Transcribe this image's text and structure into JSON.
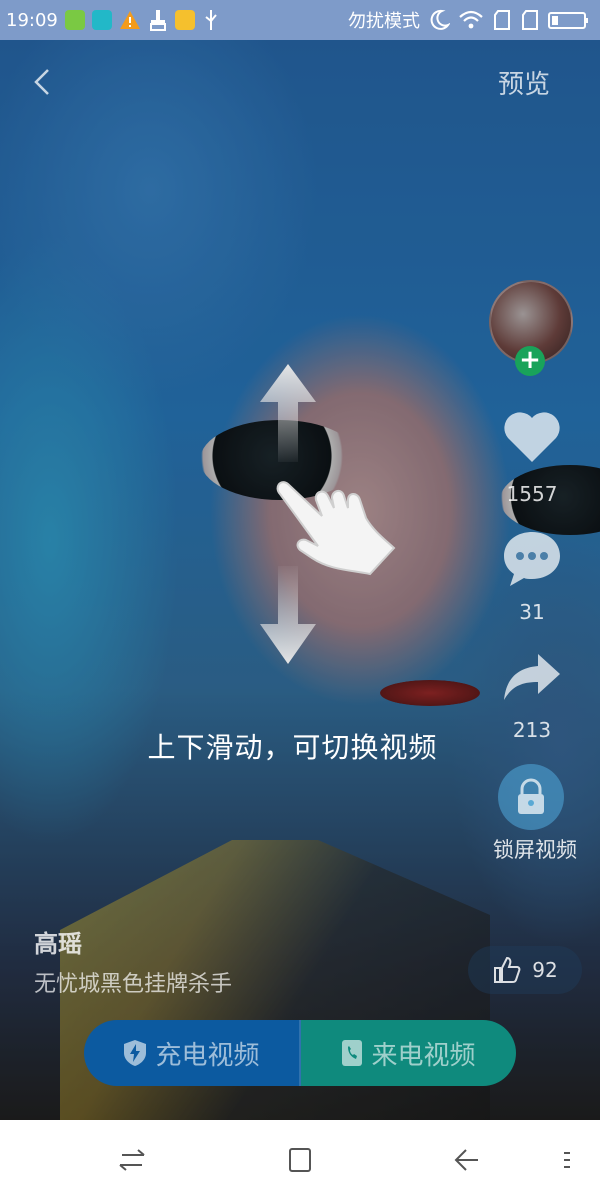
{
  "status_bar": {
    "time": "19:09",
    "dnd_text": "勿扰模式"
  },
  "header": {
    "preview_label": "预览"
  },
  "rail": {
    "like_count": "1557",
    "comment_count": "31",
    "share_count": "213",
    "lock_label": "锁屏视频"
  },
  "guide": {
    "text": "上下滑动，可切换视频"
  },
  "author": {
    "name": "高瑶",
    "description": "无忧城黑色挂牌杀手"
  },
  "thumbs": {
    "count": "92"
  },
  "actions": {
    "charge_label": "充电视频",
    "call_label": "来电视频"
  },
  "colors": {
    "follow_green": "#19a35a",
    "charge_blue": "#0c5aa0",
    "call_teal": "#0f8a7d",
    "status_bar": "#7e9bc9"
  }
}
